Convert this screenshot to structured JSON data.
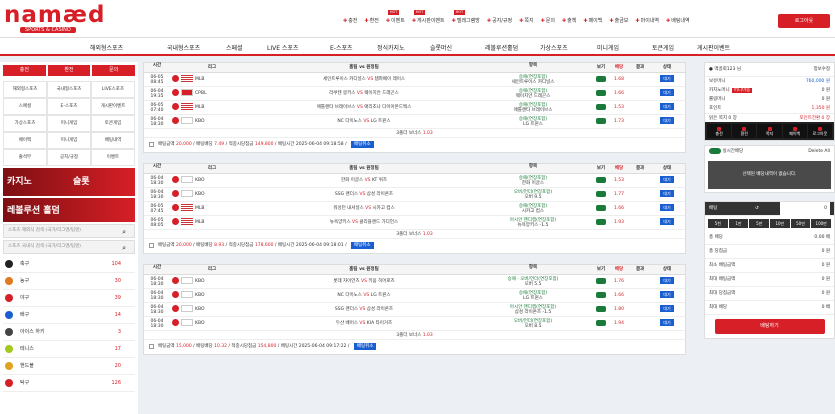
{
  "logo": {
    "main": "namæd",
    "sub": "SPORTS & CASINO"
  },
  "topnav": [
    {
      "label": "충전",
      "hot": ""
    },
    {
      "label": "환전",
      "hot": ""
    },
    {
      "label": "이벤트",
      "hot": "HOT"
    },
    {
      "label": "게시판이벤트",
      "hot": "HOT"
    },
    {
      "label": "텔레그램방",
      "hot": "HOT"
    },
    {
      "label": "공지/규정",
      "hot": ""
    },
    {
      "label": "쪽지",
      "hot": ""
    },
    {
      "label": "문의",
      "hot": ""
    },
    {
      "label": "출첵",
      "hot": ""
    },
    {
      "label": "페이백",
      "hot": ""
    },
    {
      "label": "출금보",
      "hot": ""
    },
    {
      "label": "마이내역",
      "hot": ""
    },
    {
      "label": "배팅내역",
      "hot": ""
    }
  ],
  "logout": "로그아웃",
  "categories": [
    "해외형스포츠",
    "국내형스포츠",
    "스페셜",
    "LIVE 스포츠",
    "E-스포츠",
    "정식카지노",
    "슬롯머신",
    "레볼루션홀덤",
    "가상스포츠",
    "미니게임",
    "토큰게임",
    "게시판이벤트"
  ],
  "left": {
    "buttons": [
      "충전",
      "환전",
      "문의"
    ],
    "grid": [
      "해외형스포츠",
      "국내형스포츠",
      "LIVE스포츠",
      "스페셜",
      "E-스포츠",
      "게시판이벤트",
      "가상스포츠",
      "미니게임",
      "토큰게임",
      "페이백",
      "미니게임",
      "배팅내역",
      "출석부",
      "공지/규정",
      "이벤트"
    ],
    "banner1a": "카지노",
    "banner1b": "슬롯",
    "banner2": "레볼루션 홀덤",
    "search1": "스포츠 해외식 검색 (국가/리그명/팀명)",
    "search2": "스포츠 국내식 검색 (국가/리그명/팀명)",
    "sports": [
      {
        "name": "축구",
        "count": "104",
        "color": "#222"
      },
      {
        "name": "농구",
        "count": "30",
        "color": "#e07a1f"
      },
      {
        "name": "야구",
        "count": "39",
        "color": "#d61f26"
      },
      {
        "name": "배구",
        "count": "14",
        "color": "#1a5fd1"
      },
      {
        "name": "아이스 하키",
        "count": "3",
        "color": "#444"
      },
      {
        "name": "테니스",
        "count": "17",
        "color": "#a3c91a"
      },
      {
        "name": "핸드볼",
        "count": "20",
        "color": "#e0a21f"
      },
      {
        "name": "탁구",
        "count": "126",
        "color": "#d61f26"
      }
    ]
  },
  "table_headers": [
    "시간",
    "리그",
    "홈팀 vs 원정팀",
    "항목",
    "보기",
    "배당",
    "결과",
    "상태"
  ],
  "slips": [
    {
      "rows": [
        {
          "date": "06-05",
          "time": "08:45",
          "league": "MLB",
          "flag": "us",
          "home": "세인트루이스 카디널스",
          "away": "탬파베이 레이스",
          "item1": "승패(연장포함)",
          "item2": "세인트루이스 카디널스",
          "odds": "1.68",
          "status": "대기"
        },
        {
          "date": "06-04",
          "time": "19:35",
          "league": "CPBL",
          "flag": "tw",
          "home": "라쿠텐 몽키스",
          "away": "웨이치안 드래곤스",
          "item1": "승패(연장포함)",
          "item2": "웨이치안 드래곤스",
          "odds": "1.66",
          "status": "대기"
        },
        {
          "date": "06-05",
          "time": "07:40",
          "league": "MLB",
          "flag": "us",
          "home": "애틀랜타 브레이브스",
          "away": "애리조나 다이아몬드백스",
          "item1": "승패(연장포함)",
          "item2": "애틀랜타 브레이브스",
          "odds": "1.53",
          "status": "대기"
        },
        {
          "date": "06-04",
          "time": "18:30",
          "league": "KBO",
          "flag": "kr",
          "home": "NC 다이노스",
          "away": "LG 트윈스",
          "item1": "승패(연장포함)",
          "item2": "LG 트윈스",
          "odds": "1.73",
          "status": "대기"
        }
      ],
      "bonus_label": "3폴더 보너스",
      "bonus": "1.03",
      "amount": "20,000",
      "total_odds": "7.49",
      "win": "149,800",
      "bet_time": "2025-06-04 09:18:58",
      "cancel": "배팅취소"
    },
    {
      "rows": [
        {
          "date": "06-04",
          "time": "18:30",
          "league": "KBO",
          "flag": "kr",
          "home": "한화 이글스",
          "away": "KT 위즈",
          "item1": "승패(연장포함)",
          "item2": "한화 이글스",
          "odds": "1.53",
          "status": "대기"
        },
        {
          "date": "06-04",
          "time": "18:30",
          "league": "KBO",
          "flag": "kr",
          "home": "SSG 랜더스",
          "away": "삼성 라이온즈",
          "item1": "오버/언더(연장포함)",
          "item2": "오버 9.5",
          "odds": "1.77",
          "status": "대기"
        },
        {
          "date": "06-05",
          "time": "07:45",
          "league": "MLB",
          "flag": "us",
          "home": "워싱턴 내셔널스",
          "away": "시카고 컵스",
          "item1": "승패(연장포함)",
          "item2": "시카고 컵스",
          "odds": "1.66",
          "status": "대기"
        },
        {
          "date": "06-05",
          "time": "08:05",
          "league": "MLB",
          "flag": "us",
          "home": "뉴욕양키스",
          "away": "클리블랜드 가디언스",
          "item1": "아시안 핸디캡(연장포함)",
          "item2": "뉴욕양키스 -1.5",
          "odds": "1.93",
          "status": "대기"
        }
      ],
      "bonus_label": "3폴더 보너스",
      "bonus": "1.03",
      "amount": "20,000",
      "total_odds": "8.93",
      "win": "178,600",
      "bet_time": "2025-06-04 09:18:01",
      "cancel": "배팅취소"
    },
    {
      "rows": [
        {
          "date": "06-04",
          "time": "18:30",
          "league": "KBO",
          "flag": "kr",
          "home": "롯데 자이언츠",
          "away": "키움 히어로즈",
          "item1": "승패 · 오버/언더(연장포함)",
          "item2": "오버 5.5",
          "odds": "1.76",
          "status": "대기"
        },
        {
          "date": "06-04",
          "time": "18:30",
          "league": "KBO",
          "flag": "kr",
          "home": "NC 다이노스",
          "away": "LG 트윈스",
          "item1": "승패(연장포함)",
          "item2": "LG 트윈스",
          "odds": "1.66",
          "status": "대기"
        },
        {
          "date": "06-04",
          "time": "18:30",
          "league": "KBO",
          "flag": "kr",
          "home": "SSG 랜더스",
          "away": "삼성 라이온즈",
          "item1": "아시안 핸디캡(연장포함)",
          "item2": "삼성 라이온즈 -1.5",
          "odds": "1.80",
          "status": "대기"
        },
        {
          "date": "06-04",
          "time": "18:30",
          "league": "KBO",
          "flag": "kr",
          "home": "두산 베어스",
          "away": "KIA 타이거즈",
          "item1": "오버/언더(연장포함)",
          "item2": "오버 8.5",
          "odds": "1.94",
          "status": "대기"
        }
      ],
      "bonus_label": "3폴더 보너스",
      "bonus": "1.03",
      "amount": "15,000",
      "total_odds": "10.32",
      "win": "154,800",
      "bet_time": "2025-06-04 09:17:22",
      "cancel": "배팅취소"
    }
  ],
  "labels": {
    "amount": "배팅금액",
    "odds": "배팅배당",
    "win": "적중시당첨금",
    "time": "배팅시간",
    "vs": "VS"
  },
  "right": {
    "user": "맥골회123 님",
    "info": "정보수정",
    "rows": [
      {
        "label": "보유머니",
        "value": "760,000 원"
      },
      {
        "label": "카지노머니",
        "badge": "머니이동",
        "value": "0 원"
      },
      {
        "label": "롤링머니",
        "value": "0 원"
      },
      {
        "label": "포인트",
        "value": "1,350 원"
      }
    ],
    "unread": "읽은 쪽지 0 장",
    "pointswap": "포인트전환 0 장",
    "icons": [
      "충전",
      "환전",
      "쪽지",
      "페이백",
      "로그아웃"
    ],
    "realtime": "실시간배당",
    "delete_all": "Delete All",
    "slip_empty": "선택된 배당내역이 없습니다.",
    "bet_label": "배팅",
    "bet_value": "0",
    "chips": [
      "5천",
      "1만",
      "5만",
      "10만",
      "50만",
      "100만"
    ],
    "summary": [
      {
        "label": "총 배당",
        "value": "0.00 배"
      },
      {
        "label": "총 당첨금",
        "value": "0 원"
      },
      {
        "label": "최소 배팅금액",
        "value": "0 원"
      },
      {
        "label": "최대 배팅금액",
        "value": "0 원"
      },
      {
        "label": "최대 당첨금액",
        "value": "0 원"
      },
      {
        "label": "최대 배당",
        "value": "0 배"
      }
    ],
    "do_bet": "배팅하기"
  }
}
